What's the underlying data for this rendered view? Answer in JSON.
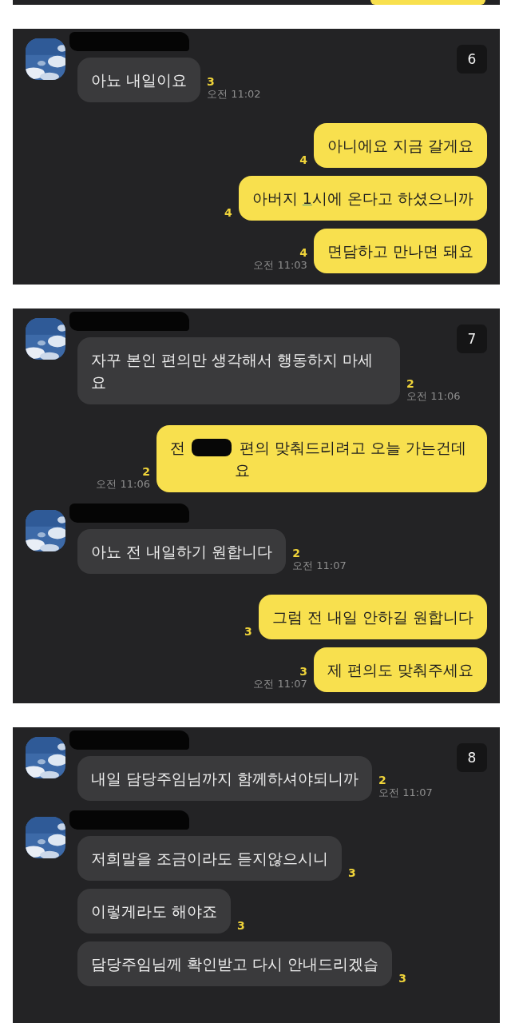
{
  "panels": [
    {
      "page_number": "6",
      "messages": [
        {
          "kind": "received",
          "show_avatar": true,
          "text": "아뇨 내일이요",
          "unread": "3",
          "time": "오전 11:02"
        },
        {
          "kind": "sent",
          "text": "아니에요 지금 갈게요",
          "unread": "4"
        },
        {
          "kind": "sent",
          "parts": [
            {
              "kind": "text",
              "text": "아버지 "
            },
            {
              "kind": "link",
              "text": "1"
            },
            {
              "kind": "text",
              "text": "시에 온다고 하셨으니까"
            }
          ],
          "unread": "4"
        },
        {
          "kind": "sent",
          "text": "면담하고 만나면 돼요",
          "unread": "4",
          "time": "오전 11:03"
        }
      ]
    },
    {
      "page_number": "7",
      "messages": [
        {
          "kind": "received",
          "show_avatar": true,
          "text": "자꾸 본인 편의만 생각해서 행동하지 마세요",
          "unread": "2",
          "time": "오전 11:06"
        },
        {
          "kind": "sent",
          "parts": [
            {
              "kind": "text",
              "text": "전 "
            },
            {
              "kind": "redacted"
            },
            {
              "kind": "text",
              "text": " 편의 맞춰드리려고 오늘 가는건데요"
            }
          ],
          "unread": "2",
          "time": "오전 11:06"
        },
        {
          "kind": "received",
          "show_avatar": true,
          "text": "아뇨 전 내일하기 원합니다",
          "unread": "2",
          "time": "오전 11:07"
        },
        {
          "kind": "sent",
          "text": "그럼 전 내일 안하길 원합니다",
          "unread": "3"
        },
        {
          "kind": "sent",
          "text": "제 편의도 맞춰주세요",
          "unread": "3",
          "time": "오전 11:07"
        }
      ]
    },
    {
      "page_number": "8",
      "messages": [
        {
          "kind": "received",
          "show_avatar": true,
          "text": "내일 담당주임님까지 함께하셔야되니까",
          "unread": "2",
          "time": "오전 11:07"
        },
        {
          "kind": "received",
          "show_avatar": true,
          "text": "저희말을 조금이라도 듣지않으시니",
          "unread": "3"
        },
        {
          "kind": "received",
          "show_avatar": false,
          "text": "이렇게라도 해야죠",
          "unread": "3"
        },
        {
          "kind": "received",
          "show_avatar": false,
          "text": "담당주임님께 확인받고 다시 안내드리겠습",
          "unread": "3"
        }
      ]
    }
  ]
}
